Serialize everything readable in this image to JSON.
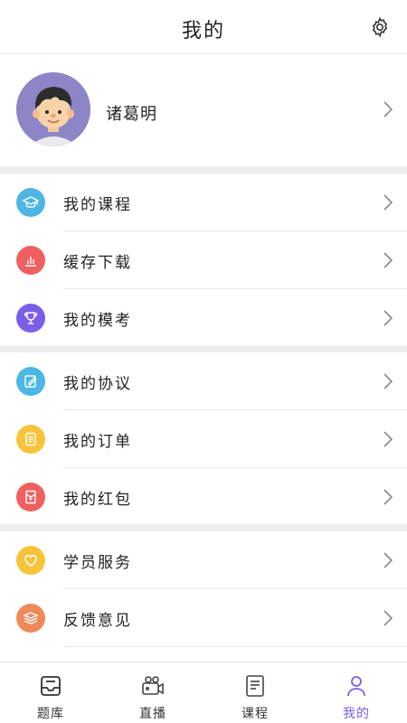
{
  "header": {
    "title": "我的"
  },
  "profile": {
    "name": "诸葛明"
  },
  "menu": [
    {
      "label": "我的课程",
      "color": "#4fb6e4",
      "icon": "graduation-cap"
    },
    {
      "label": "缓存下载",
      "color": "#ee6160",
      "icon": "bar-chart"
    },
    {
      "label": "我的模考",
      "color": "#7b5ee8",
      "icon": "trophy"
    },
    {
      "label": "我的协议",
      "color": "#4ab7e6",
      "icon": "edit-document"
    },
    {
      "label": "我的订单",
      "color": "#f6c33a",
      "icon": "order-list"
    },
    {
      "label": "我的红包",
      "color": "#ee6160",
      "icon": "red-envelope"
    },
    {
      "label": "学员服务",
      "color": "#f6c33a",
      "icon": "heart"
    },
    {
      "label": "反馈意见",
      "color": "#ee8a5a",
      "icon": "stack"
    }
  ],
  "tabs": [
    {
      "label": "题库",
      "icon": "inbox-tray"
    },
    {
      "label": "直播",
      "icon": "video-camera"
    },
    {
      "label": "课程",
      "icon": "book"
    },
    {
      "label": "我的",
      "icon": "user"
    }
  ]
}
